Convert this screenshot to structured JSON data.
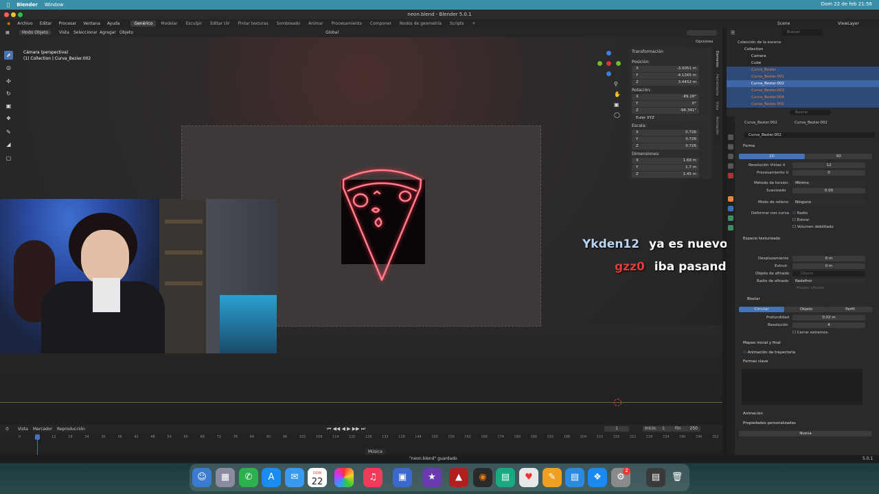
{
  "menubar": {
    "app": "Blender",
    "window": "Window",
    "datetime": "Dom 22 de feb  21:56"
  },
  "titlebar": {
    "title": "neon.blend - Blender 5.0.1"
  },
  "blender_menu": [
    "Archivo",
    "Editar",
    "Procesar",
    "Ventana",
    "Ayuda"
  ],
  "workspaces": [
    "Genérico",
    "Modelar",
    "Esculpir",
    "Editar UV",
    "Pintar texturas",
    "Sombreado",
    "Animar",
    "Procesamiento",
    "Componer",
    "Nodos de geometría",
    "Scripts"
  ],
  "toolheader": {
    "mode": "Modo Objeto",
    "menus": [
      "Vista",
      "Seleccionar",
      "Agregar",
      "Objeto"
    ],
    "transform": "Global",
    "options": "Opciones",
    "scene": "Scene",
    "viewlayer": "ViewLayer"
  },
  "viewport": {
    "camera": "Cámara (perspectiva)",
    "collection": "(1) Collection | Curva_Bezier.002"
  },
  "npanel": {
    "tabs": [
      "Elemento",
      "Herramienta",
      "Vista",
      "Animación"
    ],
    "title": "Transformación",
    "pos_label": "Posición:",
    "pos": [
      {
        "axis": "X",
        "v": "-3.0051 m"
      },
      {
        "axis": "Y",
        "v": "-4.1265 m"
      },
      {
        "axis": "Z",
        "v": "3.4452 m"
      }
    ],
    "rot_label": "Rotación:",
    "rot": [
      {
        "axis": "X",
        "v": "-89.18°"
      },
      {
        "axis": "Y",
        "v": "0°"
      },
      {
        "axis": "Z",
        "v": "-96.341°"
      }
    ],
    "rot_mode": "Euler XYZ",
    "scale_label": "Escala:",
    "scale": [
      {
        "axis": "X",
        "v": "0.726"
      },
      {
        "axis": "Y",
        "v": "0.726"
      },
      {
        "axis": "Z",
        "v": "0.726"
      }
    ],
    "dim_label": "Dimensiones:",
    "dim": [
      {
        "axis": "X",
        "v": "1.69 m"
      },
      {
        "axis": "Y",
        "v": "1.7 m"
      },
      {
        "axis": "Z",
        "v": "1.45 m"
      }
    ]
  },
  "chat": [
    {
      "user": "Ykden12",
      "msg": "ya es nuevo 🥺?",
      "color": "#b8d4f0"
    },
    {
      "user": "gzz0",
      "msg": "iba pasando 🥺",
      "color": "#e63a3a"
    }
  ],
  "outliner": {
    "search": "Buscar",
    "root": "Colección de la escena",
    "items": [
      "Collection",
      "Camera",
      "Cube",
      "Curva_Bezier",
      "Curva_Bezier.001",
      "Curva_Bezier.002",
      "Curva_Bezier.003",
      "Curva_Bezier.004",
      "Curva_Bezier.005"
    ]
  },
  "properties": {
    "search": "Buscar",
    "breadcrumb_obj": "Curva_Bezier.002",
    "breadcrumb_data": "Curva_Bezier.002",
    "datablock": "Curva_Bezier.002",
    "sec_forma": "Forma",
    "btn_2d": "2D",
    "btn_3d": "3D",
    "res_label": "Resolución  Vistas U",
    "res_val": "12",
    "proc_label": "Procesamiento U",
    "proc_val": "0",
    "twist_label": "Método de torsión",
    "twist_val": "Mínimo",
    "smooth_label": "Suavizado",
    "smooth_val": "0.00",
    "fill_label": "Modo de relleno",
    "fill_val": "Ninguno",
    "deform_label": "Deformar con curva",
    "radio": "Radio",
    "estirar": "Estirar",
    "volumen": "Volumen debilitado",
    "sec_tex": "Espacio texturizado",
    "desp_label": "Desplazamiento",
    "desp_val": "0 m",
    "extr_label": "Extruir",
    "extr_val": "0 m",
    "taper_label": "Objeto de afinado",
    "taper_ph": "Objeto",
    "taper_r_label": "Radio de afinado",
    "taper_r_val": "Redefinir",
    "taper_map": "Mapeo afinado",
    "sec_bisel": "Biselar",
    "bevel_modes": [
      "Circular",
      "Objeto",
      "Perfil"
    ],
    "depth_label": "Profundidad",
    "depth_val": "0.02 m",
    "bres_label": "Resolución",
    "bres_val": "4",
    "close_label": "Cerrar extremos",
    "sec_map": "Mapeo inicial y final",
    "sec_path": "Animación de trayectoria",
    "sec_shape": "Formas clave",
    "sec_anim": "Animación",
    "sec_custom": "Propiedades personalizadas",
    "new_btn": "Nueva"
  },
  "timeline": {
    "menus": [
      "Vista",
      "Marcador",
      "Reproducción"
    ],
    "current": "1",
    "start_label": "Inicio",
    "start": "1",
    "end_label": "Fin",
    "end": "250",
    "ticks": [
      "0",
      "6",
      "12",
      "18",
      "24",
      "30",
      "36",
      "42",
      "48",
      "54",
      "60",
      "66",
      "72",
      "78",
      "84",
      "90",
      "96",
      "102",
      "108",
      "114",
      "120",
      "126",
      "132",
      "138",
      "144",
      "150",
      "156",
      "162",
      "168",
      "174",
      "180",
      "186",
      "192",
      "198",
      "204",
      "210",
      "216",
      "222",
      "228",
      "234",
      "240",
      "246",
      "252"
    ]
  },
  "status": {
    "music": "Música",
    "saved": "\"neon.blend\" guardado",
    "version": "5.0.1"
  },
  "dock": {
    "date_day": "22",
    "date_dow": "DOM",
    "badge": "2"
  }
}
